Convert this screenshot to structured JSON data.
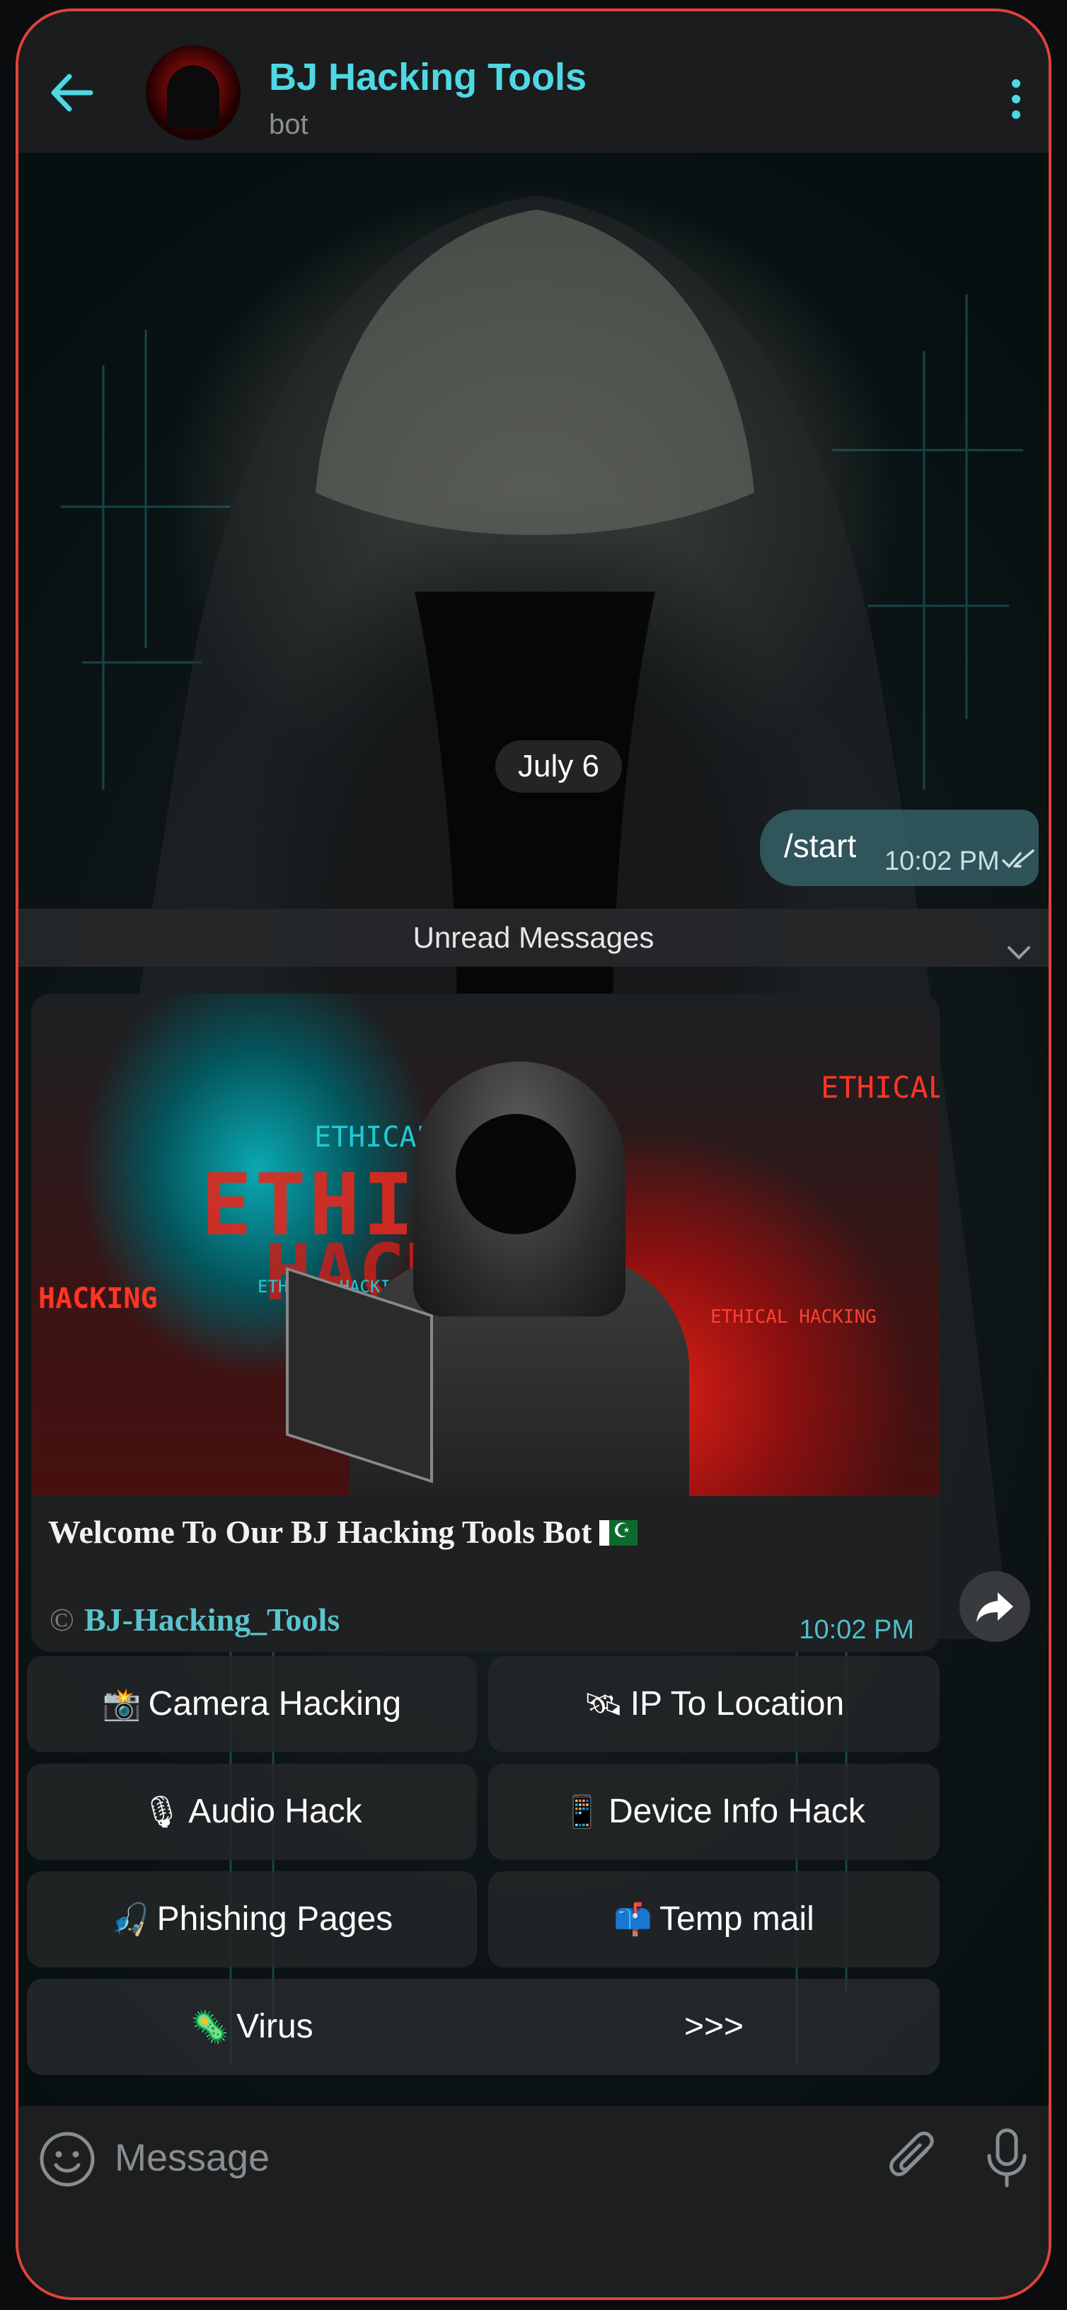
{
  "header": {
    "title": "BJ Hacking Tools",
    "subtitle": "bot",
    "back_icon": "arrow-left-icon",
    "menu_icon": "more-vertical-icon",
    "accent": "#4fd8e4"
  },
  "chat": {
    "date_label": "July 6",
    "outgoing": {
      "text": "/start",
      "time": "10:02 PM",
      "status_icon": "double-check-icon"
    },
    "unread_label": "Unread Messages",
    "incoming": {
      "image_texts": {
        "ethical_big": "ETHICA",
        "hack_big": "HACK",
        "ethical_cyan": "ETHICAL",
        "ethical_right": "ETHICAL",
        "hacking_left": "HACKING",
        "ethical_hacking_red": "ETHICAL HACKING",
        "ethical_hacking_small": "ETHICAL HACKING"
      },
      "welcome": "Welcome To Our BJ Hacking Tools Bot",
      "signature_symbol": "©",
      "signature": "BJ-Hacking_Tools",
      "time": "10:02 PM"
    }
  },
  "keyboard": [
    {
      "icon": "📸",
      "label": "Camera Hacking"
    },
    {
      "icon": "🛰",
      "label": "IP To Location"
    },
    {
      "icon": "🎙",
      "label": "Audio Hack"
    },
    {
      "icon": "📱",
      "label": "Device Info Hack"
    },
    {
      "icon": "🎣",
      "label": "Phishing Pages"
    },
    {
      "icon": "📫",
      "label": "Temp mail"
    },
    {
      "icon": "🦠",
      "label": "Virus"
    },
    {
      "icon": "",
      "label": ">>>"
    }
  ],
  "input": {
    "placeholder": "Message",
    "emoji_icon": "smile-icon",
    "attach_icon": "paperclip-icon",
    "mic_icon": "microphone-icon"
  }
}
